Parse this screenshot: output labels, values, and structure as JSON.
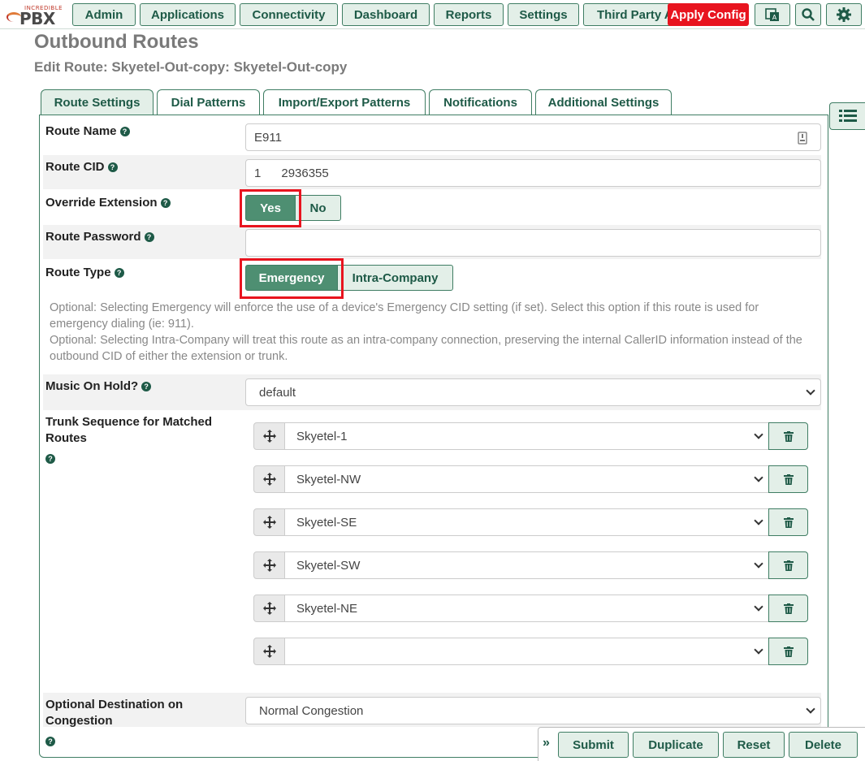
{
  "logo": {
    "small": "INCREDIBLE",
    "big": "PBX"
  },
  "nav": {
    "items": [
      "Admin",
      "Applications",
      "Connectivity",
      "Dashboard",
      "Reports",
      "Settings",
      "Third Party A"
    ],
    "apply_config": "Apply Config"
  },
  "page": {
    "title": "Outbound Routes",
    "subtitle": "Edit Route: Skyetel-Out-copy: Skyetel-Out-copy"
  },
  "tabs": [
    "Route Settings",
    "Dial Patterns",
    "Import/Export Patterns",
    "Notifications",
    "Additional Settings"
  ],
  "form": {
    "route_name_label": "Route Name",
    "route_name_value": "E911",
    "route_cid_label": "Route CID",
    "route_cid_value": "1      2936355",
    "override_label": "Override Extension",
    "override_yes": "Yes",
    "override_no": "No",
    "password_label": "Route Password",
    "password_value": "",
    "route_type_label": "Route Type",
    "route_type_emergency": "Emergency",
    "route_type_intra": "Intra-Company",
    "help_line1": "Optional: Selecting Emergency will enforce the use of a device's Emergency CID setting (if set). Select this option if this route is used for emergency dialing (ie: 911).",
    "help_line2": "Optional: Selecting Intra-Company will treat this route as an intra-company connection, preserving the internal CallerID information instead of the outbound CID of either the extension or trunk.",
    "moh_label": "Music On Hold?",
    "moh_value": "default",
    "trunk_label": "Trunk Sequence for Matched Routes",
    "trunks": [
      "Skyetel-1",
      "Skyetel-NW",
      "Skyetel-SE",
      "Skyetel-SW",
      "Skyetel-NE",
      ""
    ],
    "congestion_label": "Optional Destination on Congestion",
    "congestion_value": "Normal Congestion"
  },
  "footer": {
    "expand": "»",
    "submit": "Submit",
    "duplicate": "Duplicate",
    "reset": "Reset",
    "delete": "Delete"
  },
  "colors": {
    "accent": "#1e5a47",
    "button_bg": "#e3efe8",
    "active_toggle": "#4e8f72",
    "highlight": "#e8141f"
  }
}
